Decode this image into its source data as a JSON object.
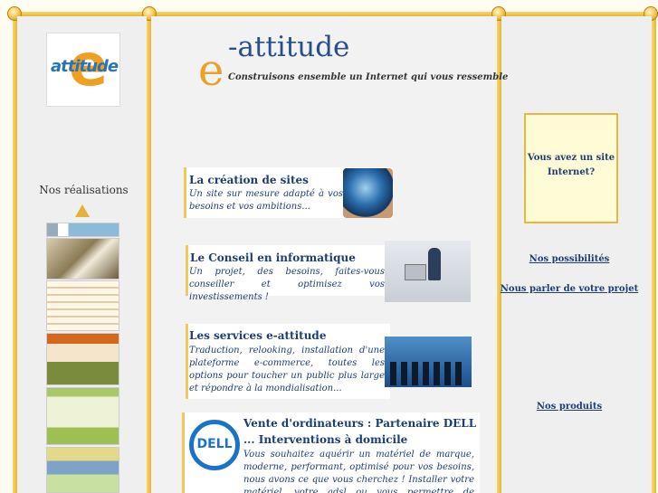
{
  "sidebar": {
    "logo_text": "attitude",
    "logo_letter": "e",
    "realisations_title": "Nos réalisations"
  },
  "header": {
    "brand_letter": "e",
    "brand_name": "-attitude",
    "tagline": "Construisons ensemble un Internet qui vous ressemble"
  },
  "services": [
    {
      "title": "La création de sites",
      "text": "Un site sur mesure adapté à vos besoins et vos ambitions..."
    },
    {
      "title": "Le Conseil en informatique",
      "text": "Un projet, des besoins, faites-vous conseiller et optimisez vos investissements !"
    },
    {
      "title": "Les services e-attitude",
      "text": "Traduction, relooking, installation d'une plateforme e-commerce, toutes les options pour toucher un public plus large et répondre à la mondialisation..."
    },
    {
      "title": "Vente d'ordinateurs : Partenaire DELL",
      "subtitle": "... Interventions à domicile",
      "text": "Vous souhaitez aquérir un matériel de marque, moderne, performant, optimisé pour vos besoins, nous avons ce que vous cherchez ! Installer votre matériel, votre adsl ou vous permettre de démarrer, nous sommes à votre service"
    }
  ],
  "dell_logo": "DELL",
  "right_panel": {
    "promo": "Vous avez un site Internet?",
    "links": [
      "Nos possibilités",
      "Nous parler de votre projet",
      "Nos produits"
    ]
  },
  "colors": {
    "gold": "#e9b53a",
    "navy": "#1d3d73",
    "accent_orange": "#e9a128"
  }
}
